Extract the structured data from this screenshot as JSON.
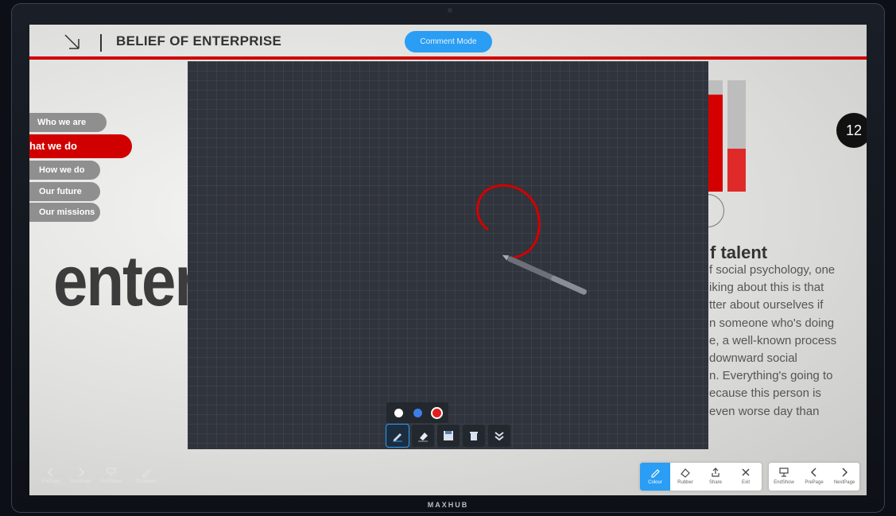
{
  "header": {
    "title": "BELIEF OF ENTERPRISE",
    "mode_button": "Comment Mode"
  },
  "nav": {
    "items": [
      {
        "label": "Who we are"
      },
      {
        "label": "hat we do",
        "active": true
      },
      {
        "label": "How we do"
      },
      {
        "label": "Our future"
      },
      {
        "label": "Our missions"
      }
    ]
  },
  "slide": {
    "big_word": "enter",
    "page_number": "12",
    "section_title": "f talent",
    "body_lines": [
      "f social psychology, one",
      "iking about this is that",
      "tter about ourselves if",
      "n someone who's doing",
      "e, a well-known process",
      "downward social",
      "n. Everything's going to",
      "ecause this person is",
      "even worse day than"
    ]
  },
  "annotation": {
    "colors": [
      "#ffffff",
      "#3d7fe6",
      "#e11d1d"
    ],
    "selected_color": "#e11d1d",
    "tools": [
      "pen-icon",
      "eraser-icon",
      "save-icon",
      "trash-icon",
      "collapse-icon"
    ]
  },
  "bottom_left": {
    "items": [
      {
        "label": "PrePage",
        "icon": "chevron-left-icon"
      },
      {
        "label": "NextPage",
        "icon": "chevron-right-icon"
      },
      {
        "label": "EndShow",
        "icon": "presentation-icon"
      },
      {
        "label": "Comment",
        "icon": "pen-icon"
      }
    ]
  },
  "toolbar": {
    "items": [
      {
        "label": "Colour",
        "icon": "pen-icon",
        "active": true
      },
      {
        "label": "Rubber",
        "icon": "eraser-icon"
      },
      {
        "label": "Share",
        "icon": "share-icon"
      },
      {
        "label": "Exit",
        "icon": "close-icon"
      }
    ]
  },
  "toolbar2": {
    "items": [
      {
        "label": "EndShow",
        "icon": "presentation-icon"
      },
      {
        "label": "PrePage",
        "icon": "chevron-left-icon"
      },
      {
        "label": "NextPage",
        "icon": "chevron-right-icon"
      }
    ]
  },
  "device": {
    "brand": "MAXHUB"
  },
  "colors": {
    "accent": "#d00000",
    "mode_blue": "#2a9df4",
    "overlay": "#30343c"
  }
}
